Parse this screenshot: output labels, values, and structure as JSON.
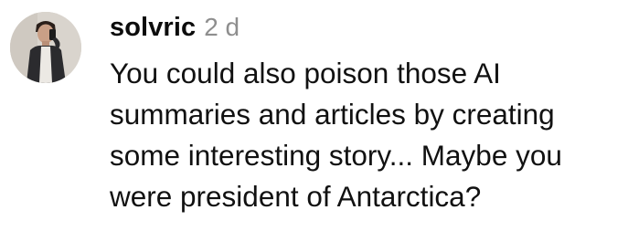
{
  "comment": {
    "avatar_icon": "user-profile-photo",
    "username": "solvric",
    "timestamp": "2 d",
    "text_lines": [
      "You could also poison those AI",
      "summaries and articles by creating",
      "some interesting story... Maybe you",
      "were president of Antarctica?"
    ]
  },
  "colors": {
    "username": "#0c0c0c",
    "timestamp": "#8e8e8e",
    "text": "#111111",
    "background": "#ffffff"
  }
}
